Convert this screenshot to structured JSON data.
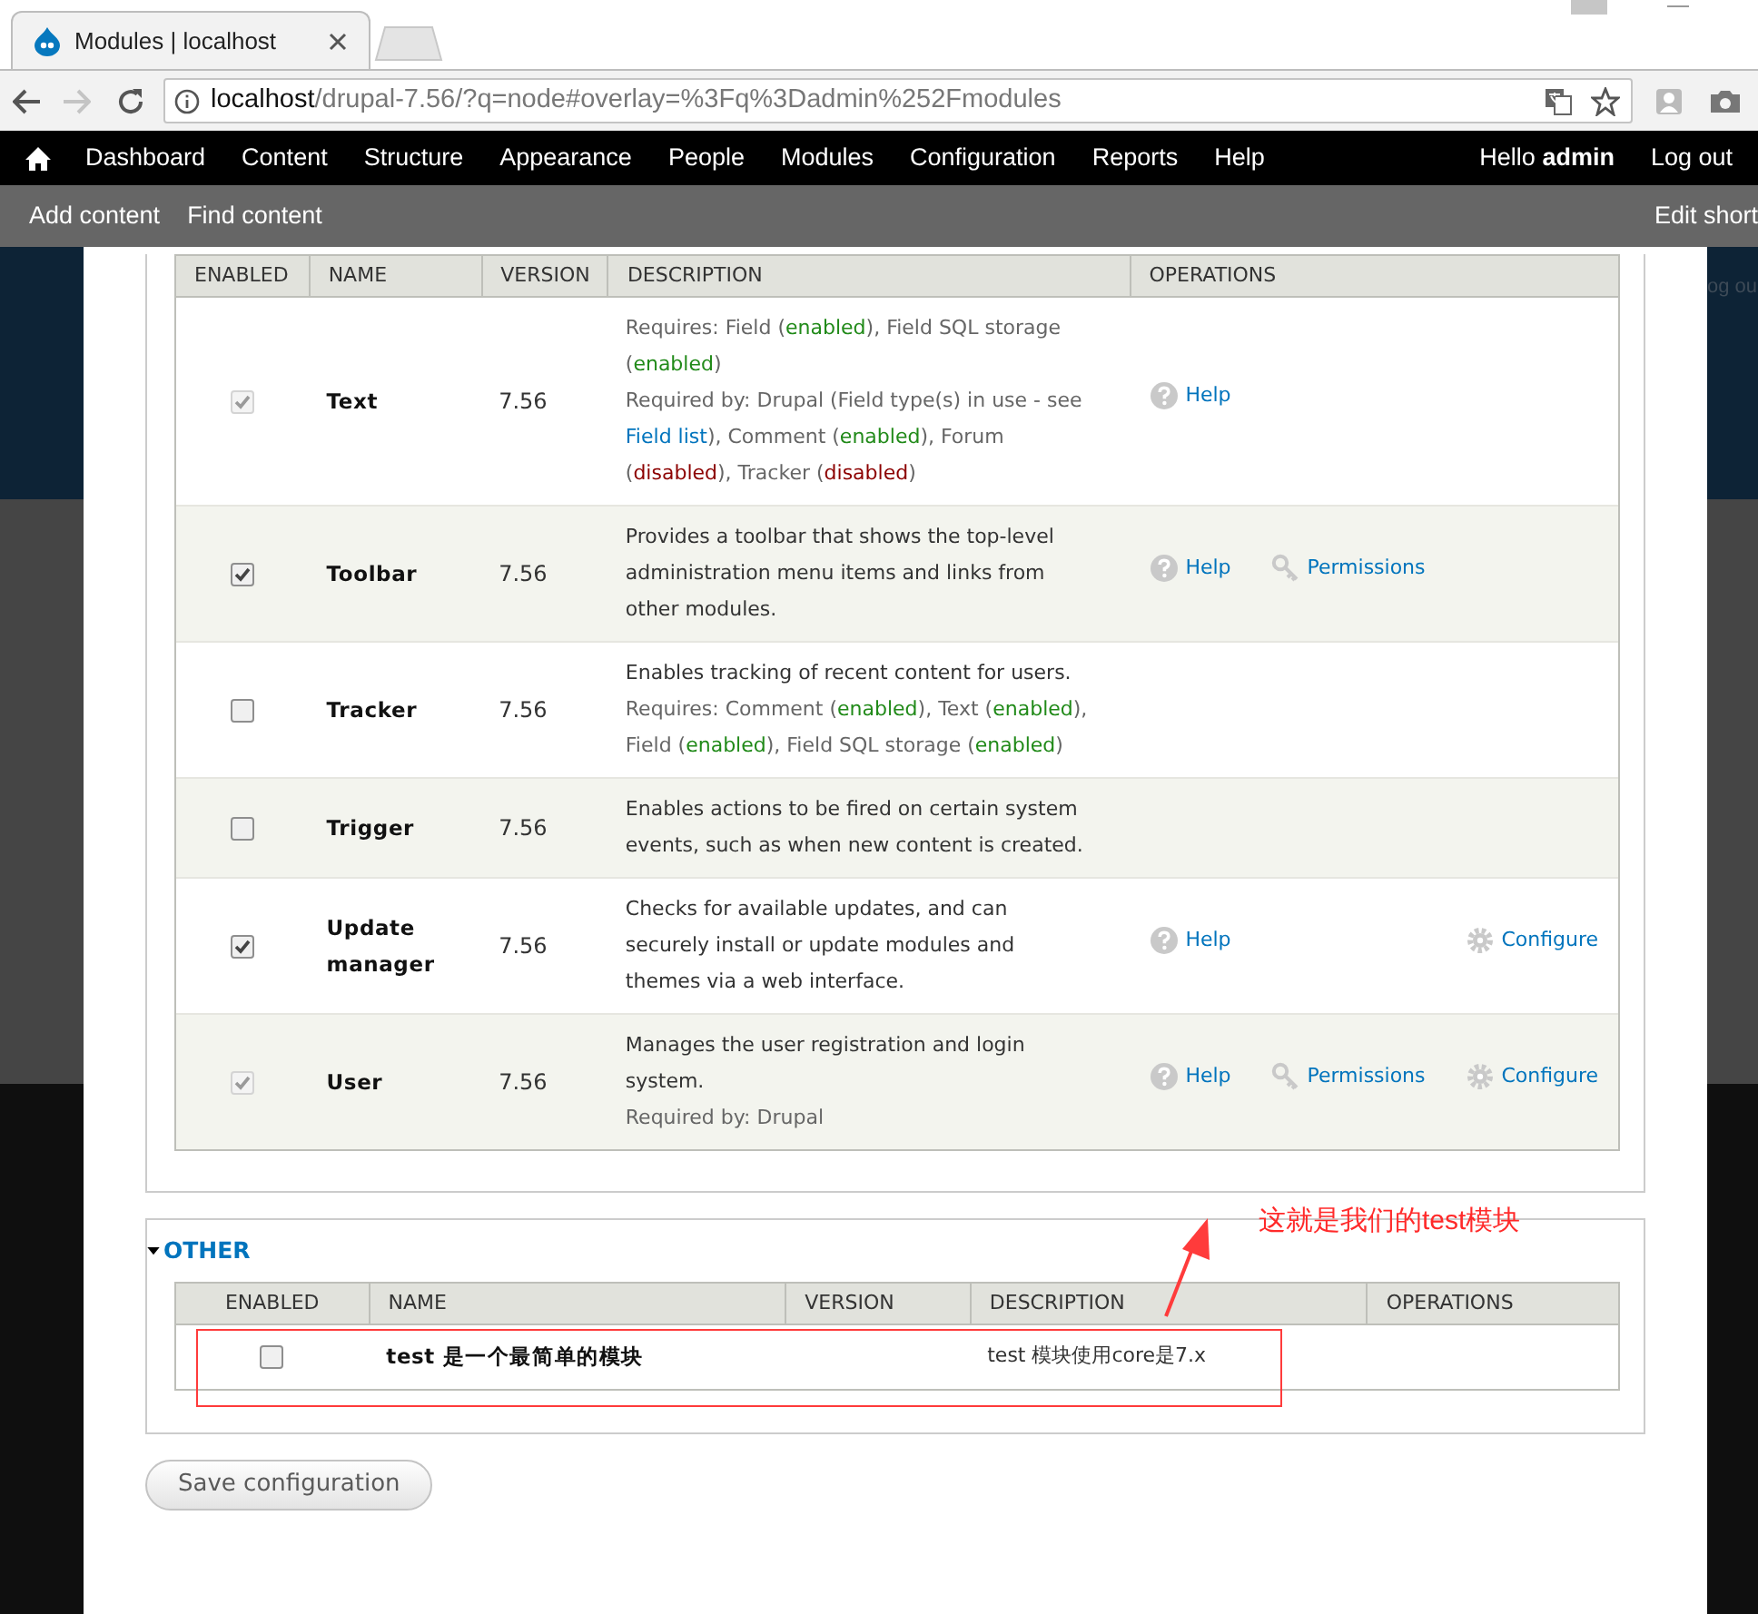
{
  "browser": {
    "tab_title": "Modules | localhost",
    "url_host": "localhost",
    "url_path": "/drupal-7.56/?q=node#overlay=%3Fq%3Dadmin%252Fmodules",
    "forward_disabled": true
  },
  "toolbar": {
    "menu": [
      "Dashboard",
      "Content",
      "Structure",
      "Appearance",
      "People",
      "Modules",
      "Configuration",
      "Reports",
      "Help"
    ],
    "greeting": "Hello **admin**",
    "logout": "Log out"
  },
  "shortcuts": {
    "items": [
      "Add content",
      "Find content"
    ],
    "edit": "Edit short"
  },
  "background_text": "og ou",
  "module_groups": [
    {
      "columns": [
        "ENABLED",
        "NAME",
        "VERSION",
        "DESCRIPTION",
        "OPERATIONS"
      ],
      "rows": [
        {
          "name": "Text",
          "version": "7.56",
          "enabled": true,
          "locked": true,
          "description": [
            {
              "kind": "note",
              "parts": [
                {
                  "kind": "plain",
                  "text": "Requires: Field ("
                },
                {
                  "kind": "on",
                  "text": "enabled"
                },
                {
                  "kind": "plain",
                  "text": "), Field SQL storage ("
                },
                {
                  "kind": "on",
                  "text": "enabled"
                },
                {
                  "kind": "plain",
                  "text": ")"
                }
              ]
            },
            {
              "kind": "note",
              "parts": [
                {
                  "kind": "plain",
                  "text": "Required by: Drupal (Field type(s) in use - see "
                },
                {
                  "kind": "link",
                  "text": "Field list"
                },
                {
                  "kind": "plain",
                  "text": "), Comment ("
                },
                {
                  "kind": "on",
                  "text": "enabled"
                },
                {
                  "kind": "plain",
                  "text": "), Forum ("
                },
                {
                  "kind": "off",
                  "text": "disabled"
                },
                {
                  "kind": "plain",
                  "text": "), Tracker ("
                },
                {
                  "kind": "off",
                  "text": "disabled"
                },
                {
                  "kind": "plain",
                  "text": ")"
                }
              ]
            }
          ],
          "operations": [
            {
              "kind": "help",
              "label": "Help"
            }
          ]
        },
        {
          "name": "Toolbar",
          "version": "7.56",
          "enabled": true,
          "locked": false,
          "description": [
            {
              "kind": "summary",
              "parts": [
                {
                  "kind": "plain",
                  "text": "Provides a toolbar that shows the top-level administration menu items and links from other modules."
                }
              ]
            }
          ],
          "operations": [
            {
              "kind": "help",
              "label": "Help"
            },
            {
              "kind": "permissions",
              "label": "Permissions"
            }
          ]
        },
        {
          "name": "Tracker",
          "version": "7.56",
          "enabled": false,
          "locked": false,
          "description": [
            {
              "kind": "summary",
              "parts": [
                {
                  "kind": "plain",
                  "text": "Enables tracking of recent content for users."
                }
              ]
            },
            {
              "kind": "note",
              "parts": [
                {
                  "kind": "plain",
                  "text": "Requires: Comment ("
                },
                {
                  "kind": "on",
                  "text": "enabled"
                },
                {
                  "kind": "plain",
                  "text": "), Text ("
                },
                {
                  "kind": "on",
                  "text": "enabled"
                },
                {
                  "kind": "plain",
                  "text": "), Field ("
                },
                {
                  "kind": "on",
                  "text": "enabled"
                },
                {
                  "kind": "plain",
                  "text": "), Field SQL storage ("
                },
                {
                  "kind": "on",
                  "text": "enabled"
                },
                {
                  "kind": "plain",
                  "text": ")"
                }
              ]
            }
          ],
          "operations": []
        },
        {
          "name": "Trigger",
          "version": "7.56",
          "enabled": false,
          "locked": false,
          "description": [
            {
              "kind": "summary",
              "parts": [
                {
                  "kind": "plain",
                  "text": "Enables actions to be fired on certain system events, such as when new content is created."
                }
              ]
            }
          ],
          "operations": []
        },
        {
          "name": "Update manager",
          "version": "7.56",
          "enabled": true,
          "locked": false,
          "description": [
            {
              "kind": "summary",
              "parts": [
                {
                  "kind": "plain",
                  "text": "Checks for available updates, and can securely install or update modules and themes via a web interface."
                }
              ]
            }
          ],
          "operations": [
            {
              "kind": "help",
              "label": "Help"
            },
            {
              "kind": "configure",
              "label": "Configure"
            }
          ]
        },
        {
          "name": "User",
          "version": "7.56",
          "enabled": true,
          "locked": true,
          "description": [
            {
              "kind": "summary",
              "parts": [
                {
                  "kind": "plain",
                  "text": "Manages the user registration and login system."
                }
              ]
            },
            {
              "kind": "note",
              "parts": [
                {
                  "kind": "plain",
                  "text": "Required by: Drupal"
                }
              ]
            }
          ],
          "operations": [
            {
              "kind": "help",
              "label": "Help"
            },
            {
              "kind": "permissions",
              "label": "Permissions"
            },
            {
              "kind": "configure",
              "label": "Configure"
            }
          ]
        }
      ]
    },
    {
      "legend": "OTHER",
      "expanded": true,
      "columns": [
        "ENABLED",
        "NAME",
        "VERSION",
        "DESCRIPTION",
        "OPERATIONS"
      ],
      "rows": [
        {
          "name": "test 是一个最简单的模块",
          "enabled": false,
          "locked": false,
          "description": [
            {
              "kind": "summary",
              "parts": [
                {
                  "kind": "plain",
                  "text": "test 模块使用core是7.x"
                }
              ]
            }
          ],
          "operations": []
        }
      ]
    }
  ],
  "save_button": "Save configuration",
  "annotation": {
    "text": "这就是我们的test模块"
  }
}
